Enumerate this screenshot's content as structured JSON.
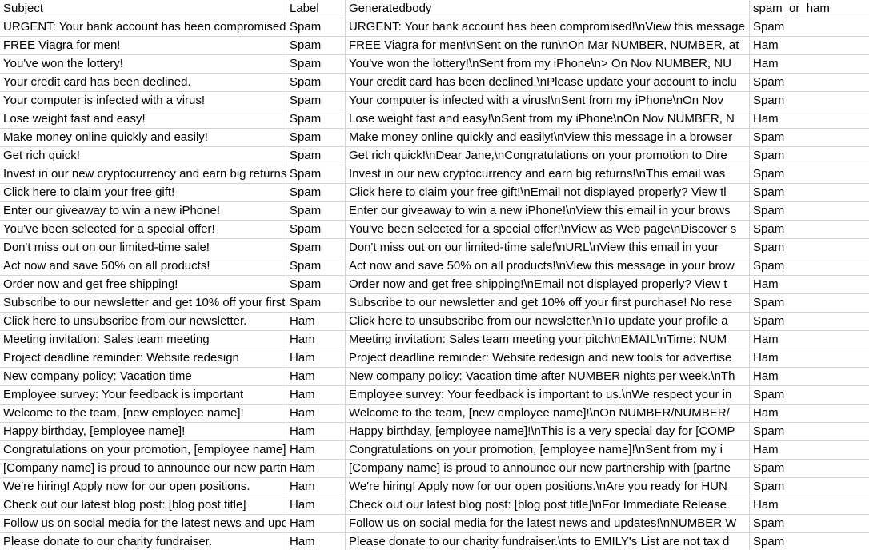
{
  "columns": [
    "Subject",
    "Label",
    "Generatedbody",
    "spam_or_ham"
  ],
  "rows": [
    [
      "URGENT: Your bank account has been compromised!",
      "Spam",
      "URGENT: Your bank account has been compromised!\\nView this message",
      "Spam"
    ],
    [
      "FREE Viagra for men!",
      "Spam",
      "FREE Viagra for men!\\nSent on the run\\nOn Mar NUMBER, NUMBER, at",
      "Ham"
    ],
    [
      "You've won the lottery!",
      "Spam",
      "You've won the lottery!\\nSent from my iPhone\\n> On Nov NUMBER, NU",
      "Ham"
    ],
    [
      "Your credit card has been declined.",
      "Spam",
      "Your credit card has been declined.\\nPlease update your account to inclu",
      "Spam"
    ],
    [
      "Your computer is infected with a virus!",
      "Spam",
      "Your computer is infected with a virus!\\nSent from my iPhone\\nOn Nov",
      "Spam"
    ],
    [
      "Lose weight fast and easy!",
      "Spam",
      "Lose weight fast and easy!\\nSent from my iPhone\\nOn Nov NUMBER, N",
      "Ham"
    ],
    [
      "Make money online quickly and easily!",
      "Spam",
      "Make money online quickly and easily!\\nView this message in a browser",
      "Spam"
    ],
    [
      "Get rich quick!",
      "Spam",
      "Get rich quick!\\nDear Jane,\\nCongratulations on your promotion to Dire",
      "Spam"
    ],
    [
      "Invest in our new cryptocurrency and earn big returns!",
      "Spam",
      "Invest in our new cryptocurrency and earn big returns!\\nThis email was",
      "Spam"
    ],
    [
      "Click here to claim your free gift!",
      "Spam",
      "Click here to claim your free gift!\\nEmail not displayed properly? View tl",
      "Spam"
    ],
    [
      "Enter our giveaway to win a new iPhone!",
      "Spam",
      "Enter our giveaway to win a new iPhone!\\nView this email in your brows",
      "Spam"
    ],
    [
      "You've been selected for a special offer!",
      "Spam",
      "You've been selected for a special offer!\\nView as Web page\\nDiscover s",
      "Spam"
    ],
    [
      "Don't miss out on our limited-time sale!",
      "Spam",
      "Don't miss out on our limited-time sale!\\nURL\\nView this email in your",
      "Spam"
    ],
    [
      "Act now and save 50% on all products!",
      "Spam",
      "Act now and save 50% on all products!\\nView this message in your brow",
      "Spam"
    ],
    [
      "Order now and get free shipping!",
      "Spam",
      "Order now and get free shipping!\\nEmail not displayed properly? View t",
      "Ham"
    ],
    [
      "Subscribe to our newsletter and get 10% off your first purchase!",
      "Spam",
      "Subscribe to our newsletter and get 10% off your first purchase! No rese",
      "Spam"
    ],
    [
      "Click here to unsubscribe from our newsletter.",
      "Ham",
      "Click here to unsubscribe from our newsletter.\\nTo update your profile a",
      "Spam"
    ],
    [
      "Meeting invitation: Sales team meeting",
      "Ham",
      "Meeting invitation: Sales team meeting your pitch\\nEMAIL\\nTime: NUM",
      "Ham"
    ],
    [
      "Project deadline reminder: Website redesign",
      "Ham",
      "Project deadline reminder: Website redesign and new tools for advertise",
      "Ham"
    ],
    [
      "New company policy: Vacation time",
      "Ham",
      "New company policy: Vacation time after NUMBER nights per week.\\nTh",
      "Ham"
    ],
    [
      "Employee survey: Your feedback is important",
      "Ham",
      "Employee survey: Your feedback is important to us.\\nWe respect your in",
      "Spam"
    ],
    [
      "Welcome to the team, [new employee name]!",
      "Ham",
      "Welcome to the team, [new employee name]!\\nOn NUMBER/NUMBER/",
      "Ham"
    ],
    [
      "Happy birthday, [employee name]!",
      "Ham",
      "Happy birthday, [employee name]!\\nThis is a very special day for [COMP",
      "Spam"
    ],
    [
      "Congratulations on your promotion, [employee name]!",
      "Ham",
      "Congratulations on your promotion, [employee name]!\\nSent from my i",
      "Ham"
    ],
    [
      "[Company name] is proud to announce our new partnership",
      "Ham",
      "[Company name] is proud to announce our new partnership with [partne",
      "Spam"
    ],
    [
      "We're hiring! Apply now for our open positions.",
      "Ham",
      "We're hiring! Apply now for our open positions.\\nAre you ready for HUN",
      "Spam"
    ],
    [
      "Check out our latest blog post: [blog post title]",
      "Ham",
      "Check out our latest blog post: [blog post title]\\nFor Immediate Release",
      "Ham"
    ],
    [
      "Follow us on social media for the latest news and updates!",
      "Ham",
      "Follow us on social media for the latest news and updates!\\nNUMBER W",
      "Spam"
    ],
    [
      "Please donate to our charity fundraiser.",
      "Ham",
      "Please donate to our charity fundraiser.\\nts to EMILY's List are not tax d",
      "Spam"
    ]
  ]
}
